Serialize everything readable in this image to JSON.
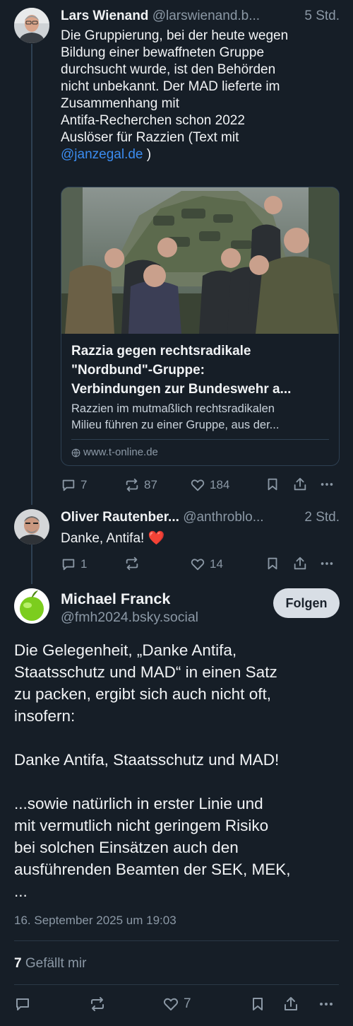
{
  "posts": [
    {
      "author": "Lars Wienand",
      "handle": "@larswienand.b...",
      "time": "5 Std.",
      "text_lines": [
        "Die Gruppierung, bei der heute wegen",
        "Bildung einer bewaffneten Gruppe",
        "durchsucht wurde, ist den Behörden",
        "nicht unbekannt. Der MAD lieferte im",
        "Zusammenhang mit",
        "Antifa-Recherchen schon 2022",
        "Auslöser für Razzien (Text mit"
      ],
      "mention": "@janzegal.de",
      "mention_suffix": " )",
      "card": {
        "title_lines": [
          "Razzia gegen rechtsradikale",
          "\"Nordbund\"-Gruppe:",
          "Verbindungen zur Bundeswehr a..."
        ],
        "desc_lines": [
          "Razzien im mutmaßlich rechtsradikalen",
          "Milieu führen zu einer Gruppe, aus der..."
        ],
        "domain": "www.t-online.de"
      },
      "actions": {
        "replies": "7",
        "reposts": "87",
        "likes": "184"
      }
    },
    {
      "author": "Oliver Rautenber...",
      "handle": "@anthroblo...",
      "time": "2 Std.",
      "text": "Danke, Antifa! ❤️",
      "actions": {
        "replies": "1",
        "reposts": "",
        "likes": "14"
      }
    }
  ],
  "main_post": {
    "author": "Michael Franck",
    "handle": "@fmh2024.bsky.social",
    "follow_label": "Folgen",
    "paragraphs": [
      [
        "Die Gelegenheit, „Danke Antifa,",
        "Staatsschutz und MAD“ in einen Satz",
        "zu packen, ergibt sich auch nicht oft,",
        "insofern:"
      ],
      [
        "Danke Antifa, Staatsschutz und MAD!"
      ],
      [
        "...sowie natürlich in erster Linie und",
        "mit vermutlich nicht geringem Risiko",
        "bei solchen Einsätzen auch den",
        "ausführenden Beamten der SEK, MEK,",
        "..."
      ]
    ],
    "date": "16. September 2025 um 19:03",
    "likes_count": "7",
    "likes_label": "Gefällt mir",
    "actions": {
      "likes": "7"
    }
  },
  "colors": {
    "background": "#161e27",
    "secondary_text": "#8b98a5",
    "link": "#3b8cf0",
    "heart": "#e8303d"
  }
}
